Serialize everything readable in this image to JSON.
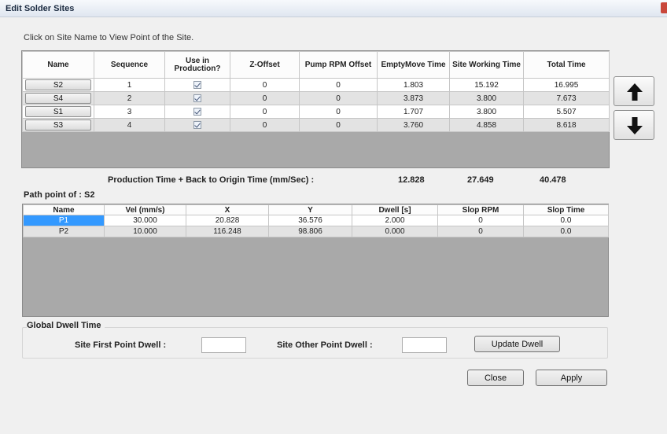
{
  "window": {
    "title": "Edit Solder Sites"
  },
  "instruction": "Click on Site Name to View Point of the Site.",
  "sites_table": {
    "headers": [
      "Name",
      "Sequence",
      "Use in Production?",
      "Z-Offset",
      "Pump RPM Offset",
      "EmptyMove Time",
      "Site Working Time",
      "Total Time"
    ],
    "rows": [
      {
        "name": "S2",
        "sequence": "1",
        "use_in_production": true,
        "z_offset": "0",
        "pump_rpm_offset": "0",
        "empty_move_time": "1.803",
        "site_working_time": "15.192",
        "total_time": "16.995"
      },
      {
        "name": "S4",
        "sequence": "2",
        "use_in_production": true,
        "z_offset": "0",
        "pump_rpm_offset": "0",
        "empty_move_time": "3.873",
        "site_working_time": "3.800",
        "total_time": "7.673"
      },
      {
        "name": "S1",
        "sequence": "3",
        "use_in_production": true,
        "z_offset": "0",
        "pump_rpm_offset": "0",
        "empty_move_time": "1.707",
        "site_working_time": "3.800",
        "total_time": "5.507"
      },
      {
        "name": "S3",
        "sequence": "4",
        "use_in_production": true,
        "z_offset": "0",
        "pump_rpm_offset": "0",
        "empty_move_time": "3.760",
        "site_working_time": "4.858",
        "total_time": "8.618"
      }
    ]
  },
  "move_buttons": {
    "up_icon": "arrow-up-icon",
    "down_icon": "arrow-down-icon"
  },
  "totals": {
    "label": "Production Time + Back to Origin Time (mm/Sec) :",
    "empty_move": "12.828",
    "working": "27.649",
    "total": "40.478"
  },
  "path_point": {
    "label": "Path point of :",
    "site": "S2"
  },
  "points_table": {
    "headers": [
      "Name",
      "Vel (mm/s)",
      "X",
      "Y",
      "Dwell [s]",
      "Slop RPM",
      "Slop Time"
    ],
    "rows": [
      {
        "name": "P1",
        "vel": "30.000",
        "x": "20.828",
        "y": "36.576",
        "dwell": "2.000",
        "slop_rpm": "0",
        "slop_time": "0.0"
      },
      {
        "name": "P2",
        "vel": "10.000",
        "x": "116.248",
        "y": "98.806",
        "dwell": "0.000",
        "slop_rpm": "0",
        "slop_time": "0.0"
      }
    ]
  },
  "global_dwell": {
    "title": "Global Dwell Time",
    "first_point_label": "Site First Point Dwell :",
    "first_point_value": "",
    "other_point_label": "Site Other Point Dwell :",
    "other_point_value": "",
    "update_button": "Update Dwell"
  },
  "actions": {
    "close": "Close",
    "apply": "Apply"
  },
  "colors": {
    "selection": "#3399ff",
    "grid_background": "#a9a9a9",
    "alt_row": "#e3e3e3"
  }
}
